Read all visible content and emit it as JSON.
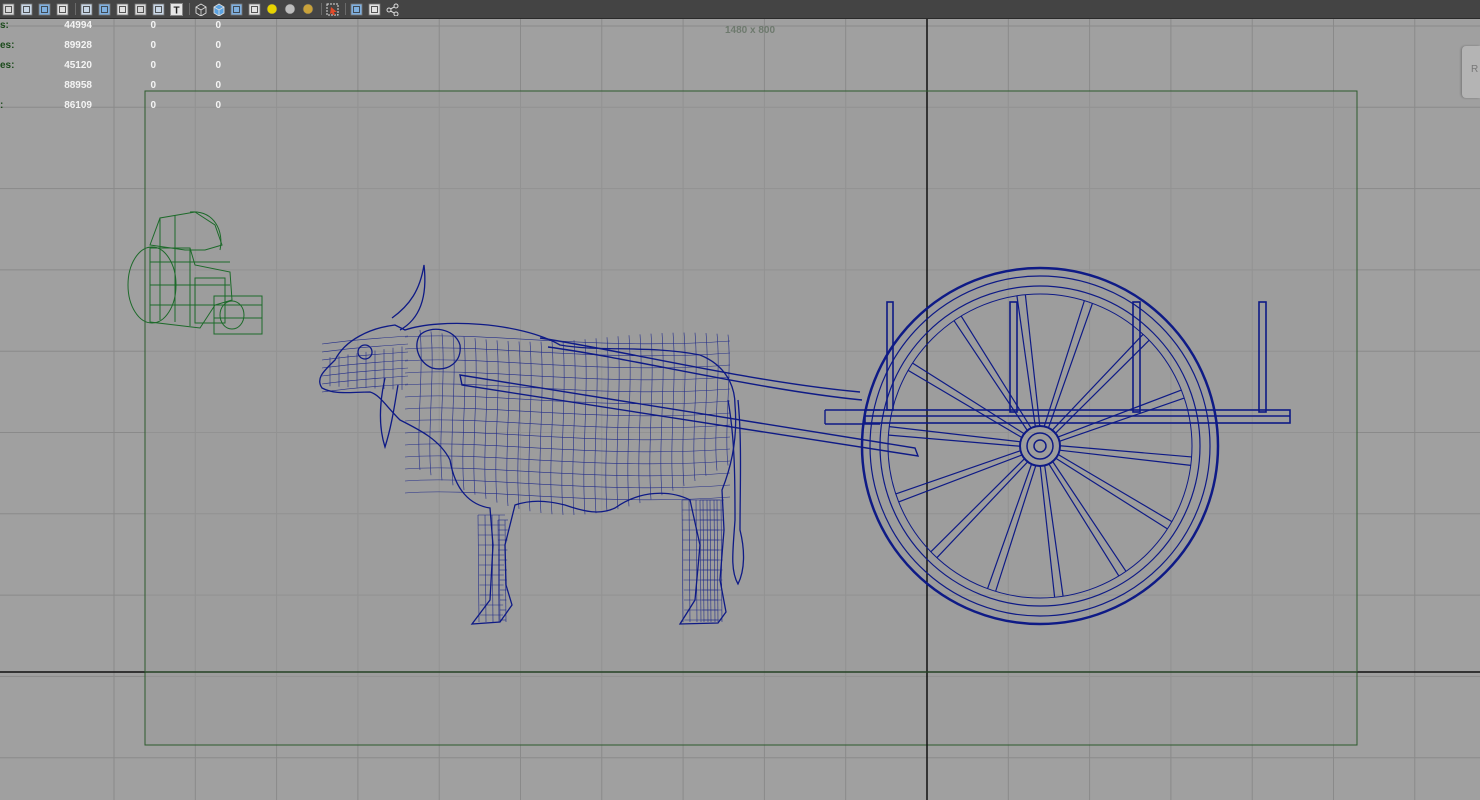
{
  "toolbar": {
    "icons": [
      "film-gate-icon",
      "image-plane-icon",
      "gate-mask-icon",
      "camera-attributes-icon",
      "separator",
      "wireframe-shading-icon",
      "resolution-gate-icon",
      "field-chart-icon",
      "safe-action-icon",
      "safe-title-icon",
      "text-overlay-icon",
      "separator",
      "wireframe-cube-icon",
      "smooth-shade-cube-icon",
      "wireframe-on-shaded-icon",
      "xray-icon",
      "default-light-icon",
      "shadow-sphere-icon",
      "textured-sphere-icon",
      "separator",
      "isolate-select-icon",
      "separator",
      "bounding-box-icon",
      "frame-all-icon",
      "joints-icon"
    ]
  },
  "hud": {
    "rows": [
      {
        "label": "s:",
        "v1": "44994",
        "v2": "0",
        "v3": "0"
      },
      {
        "label": "es:",
        "v1": "89928",
        "v2": "0",
        "v3": "0"
      },
      {
        "label": "es:",
        "v1": "45120",
        "v2": "0",
        "v3": "0"
      },
      {
        "label": "",
        "v1": "88958",
        "v2": "0",
        "v3": "0"
      },
      {
        "label": ":",
        "v1": "86109",
        "v2": "0",
        "v3": "0"
      }
    ]
  },
  "resolution_label": "1480 x 800",
  "bottom_caption": "",
  "corner_panel_text": "R",
  "colors": {
    "viewport_bg": "#a0a0a0",
    "safe_area_bg": "#9a9a9a",
    "grid": "#8a8a8a",
    "axis": "#111111",
    "gate_border": "#2d5a2d",
    "wireframe": "#0e1a86",
    "camera_wire": "#1d6a2a",
    "hud_label": "#1b4a1b",
    "hud_value": "#f4f4f4"
  }
}
